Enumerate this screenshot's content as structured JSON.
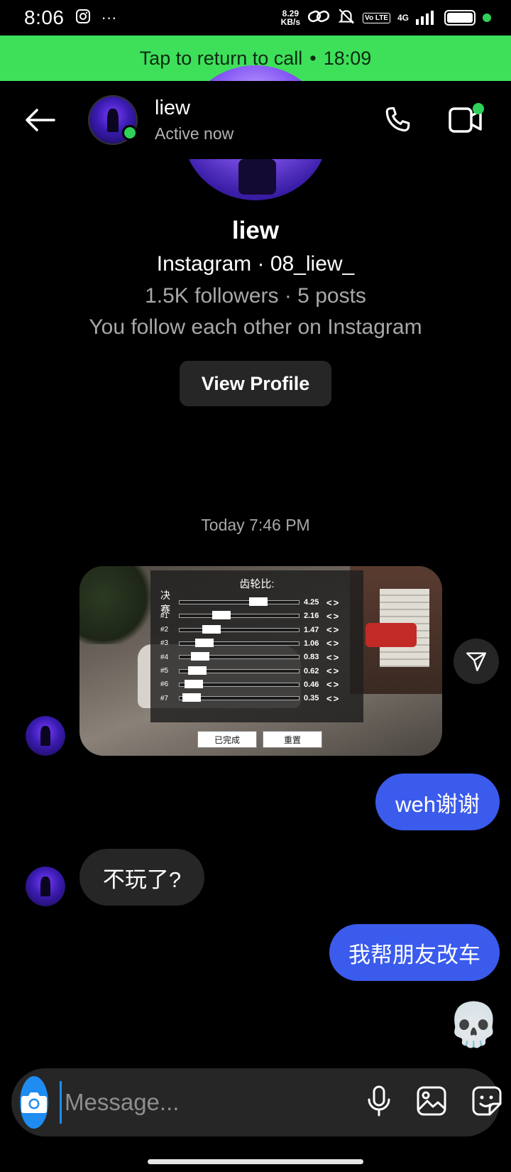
{
  "status_bar": {
    "time": "8:06",
    "more": "···",
    "net_speed_value": "8.29",
    "net_speed_unit": "KB/s",
    "volte": "Vo LTE",
    "network": "4G"
  },
  "call_banner": {
    "text": "Tap to return to call",
    "separator": "•",
    "duration": "18:09"
  },
  "header": {
    "name": "liew",
    "status": "Active now"
  },
  "profile": {
    "name": "liew",
    "handle": "Instagram · 08_liew_",
    "stats": "1.5K followers · 5 posts",
    "mutual": "You follow each other on Instagram",
    "view_profile_label": "View Profile"
  },
  "timestamp": "Today 7:46 PM",
  "image_message": {
    "panel_title": "齿轮比:",
    "gears": [
      {
        "label": "决赛",
        "value": "4.25",
        "level": 0.68
      },
      {
        "label": "#1",
        "value": "2.16",
        "level": 0.32
      },
      {
        "label": "#2",
        "value": "1.47",
        "level": 0.22
      },
      {
        "label": "#3",
        "value": "1.06",
        "level": 0.15
      },
      {
        "label": "#4",
        "value": "0.83",
        "level": 0.11
      },
      {
        "label": "#5",
        "value": "0.62",
        "level": 0.08
      },
      {
        "label": "#6",
        "value": "0.46",
        "level": 0.05
      },
      {
        "label": "#7",
        "value": "0.35",
        "level": 0.03
      }
    ],
    "arrows": "<>",
    "done_label": "已完成",
    "reset_label": "重置"
  },
  "messages": [
    {
      "from": "me",
      "text": "weh谢谢"
    },
    {
      "from": "them",
      "text": "不玩了?"
    },
    {
      "from": "me",
      "text": "我帮朋友改车"
    },
    {
      "from": "me",
      "text": "💀"
    }
  ],
  "composer": {
    "placeholder": "Message..."
  },
  "colors": {
    "call_banner": "#3ee05a",
    "sent_bubble": "#3a5bec",
    "received_bubble": "#262626",
    "online": "#2fd158",
    "camera": "#1e8cf0"
  }
}
